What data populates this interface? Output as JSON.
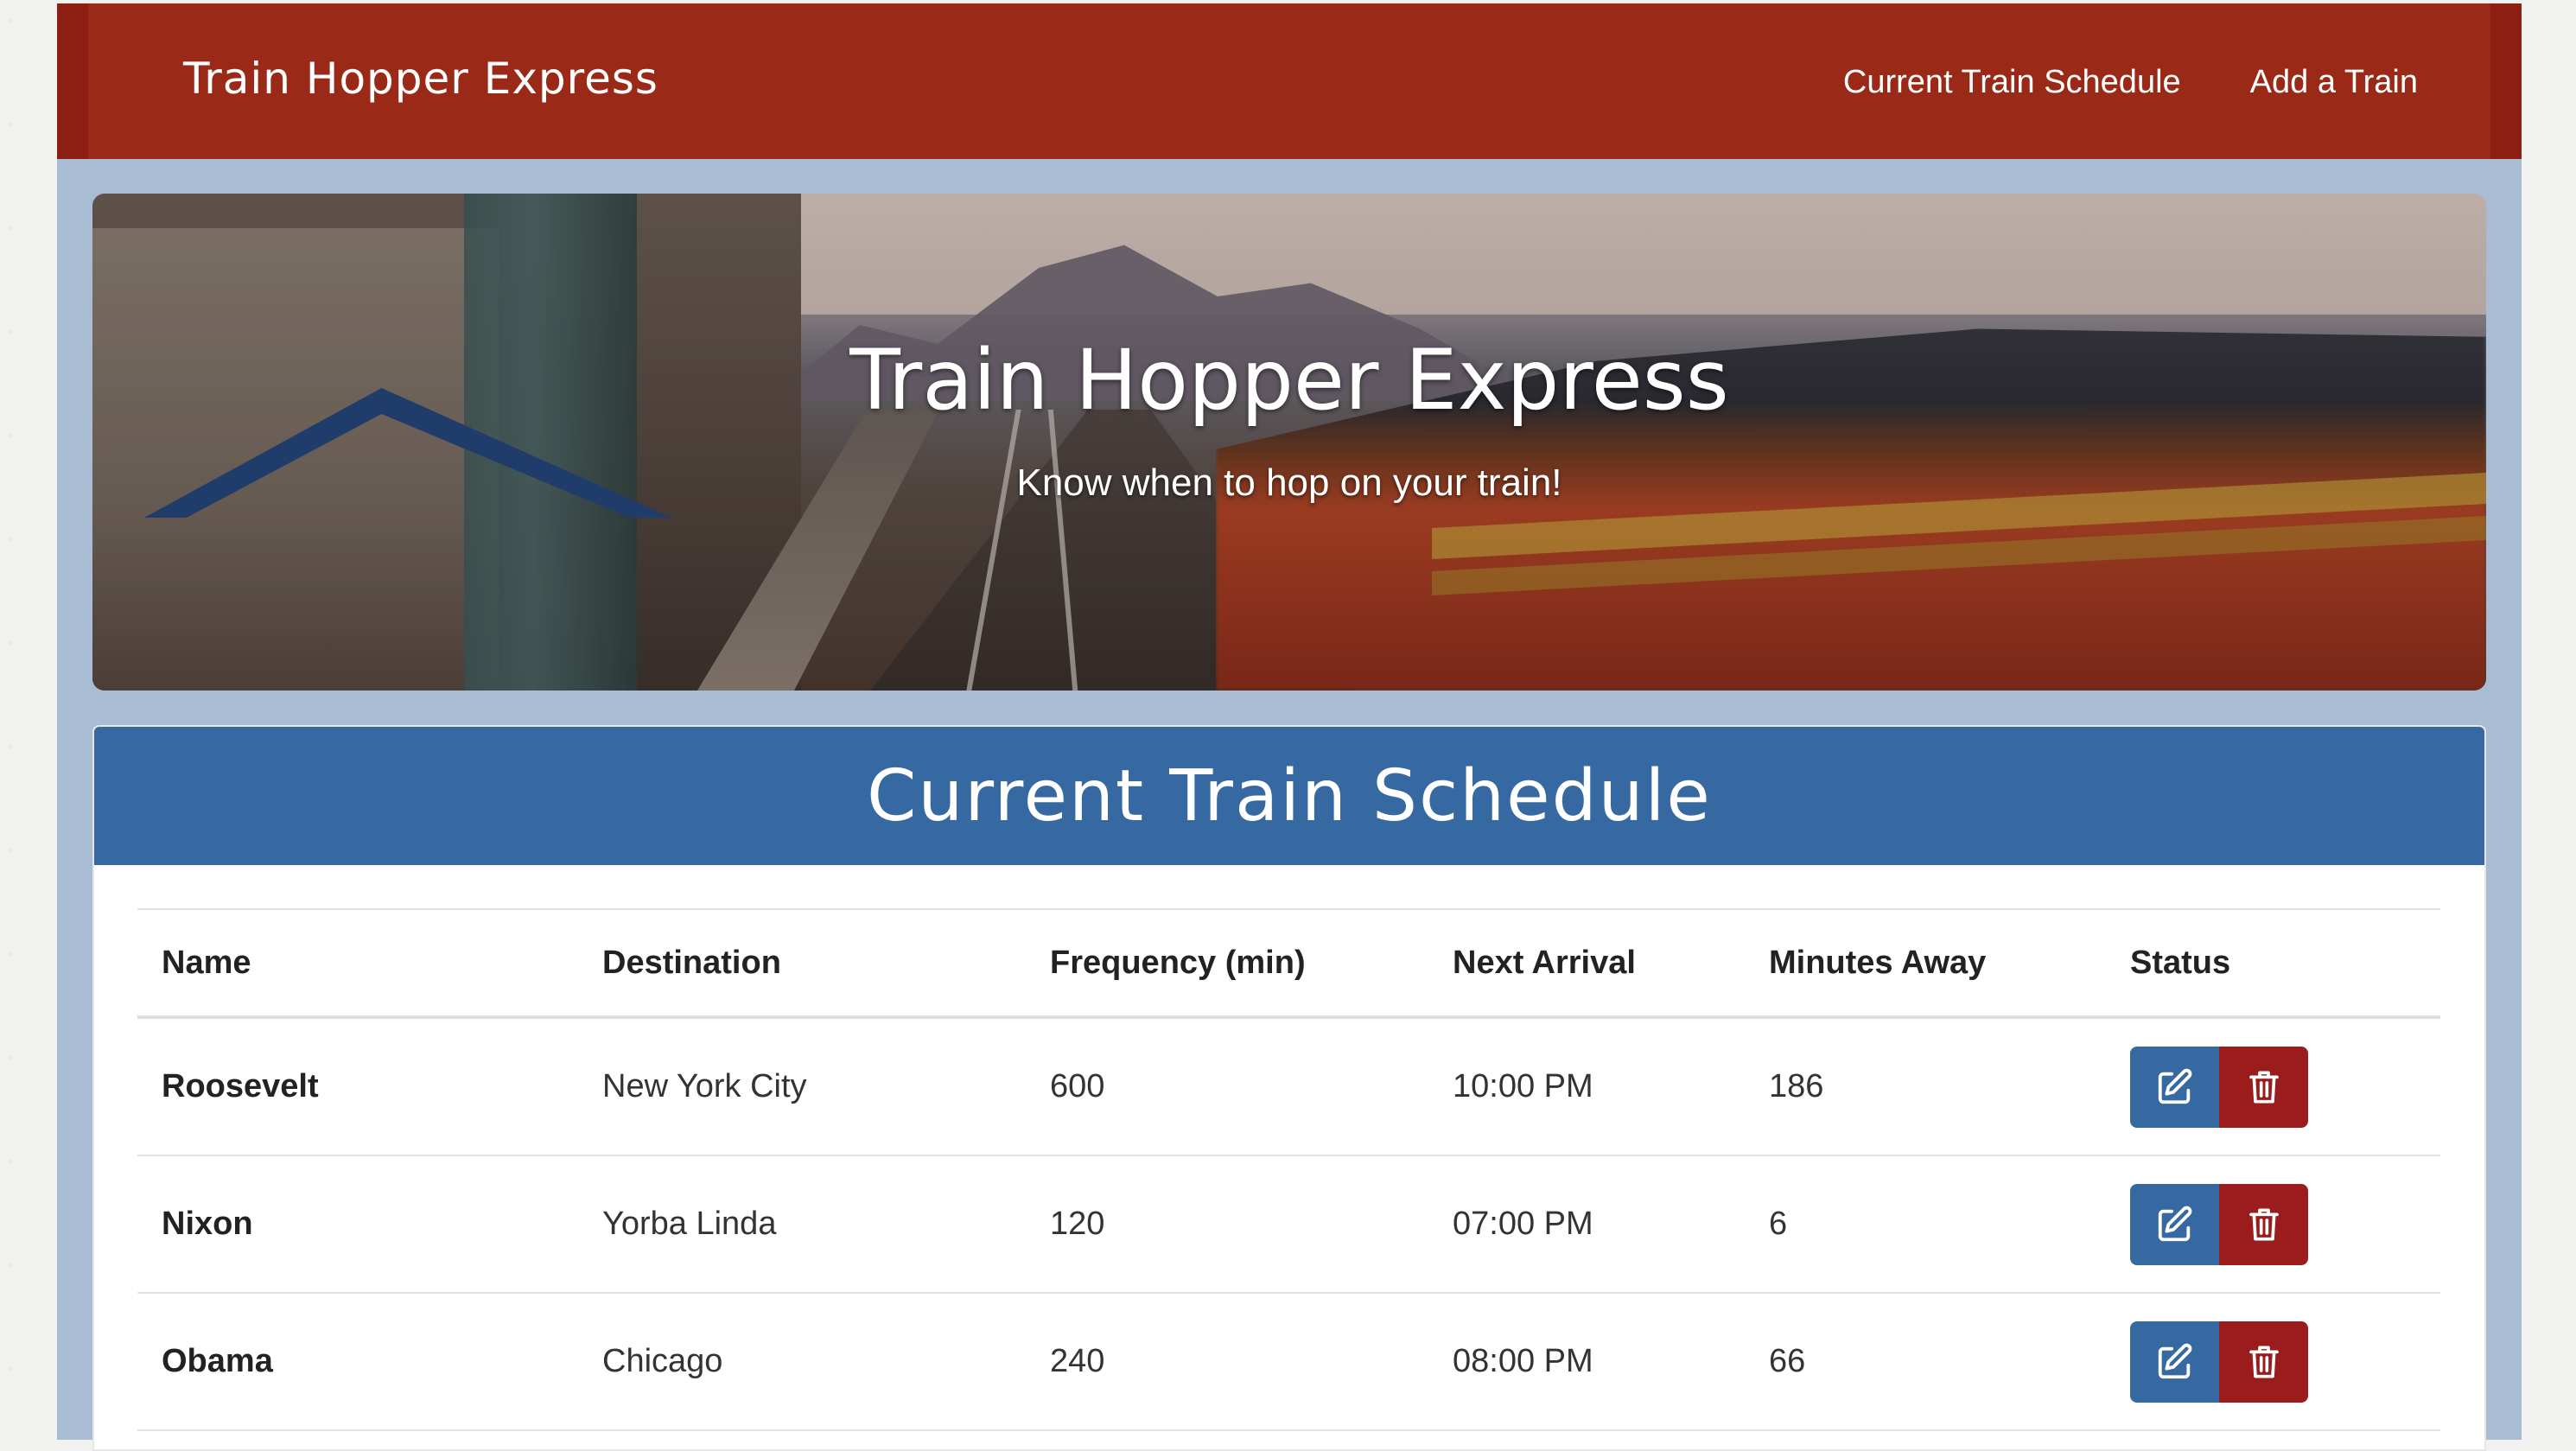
{
  "navbar": {
    "brand": "Train Hopper Express",
    "links": [
      "Current Train Schedule",
      "Add a Train"
    ]
  },
  "hero": {
    "title": "Train Hopper Express",
    "subtitle": "Know when to hop on your train!"
  },
  "schedule": {
    "title": "Current Train Schedule",
    "columns": [
      "Name",
      "Destination",
      "Frequency (min)",
      "Next Arrival",
      "Minutes Away",
      "Status"
    ],
    "rows": [
      {
        "name": "Roosevelt",
        "destination": "New York City",
        "frequency": "600",
        "next_arrival": "10:00 PM",
        "minutes_away": "186"
      },
      {
        "name": "Nixon",
        "destination": "Yorba Linda",
        "frequency": "120",
        "next_arrival": "07:00 PM",
        "minutes_away": "6"
      },
      {
        "name": "Obama",
        "destination": "Chicago",
        "frequency": "240",
        "next_arrival": "08:00 PM",
        "minutes_away": "66"
      }
    ],
    "actions": {
      "edit_icon": "edit-icon",
      "delete_icon": "trash-icon"
    }
  },
  "colors": {
    "navbar": "#9a2a17",
    "panel_header": "#3668a1",
    "edit_button": "#3668a1",
    "delete_button": "#9a1c1c",
    "page_frame": "#a8bcd3"
  }
}
